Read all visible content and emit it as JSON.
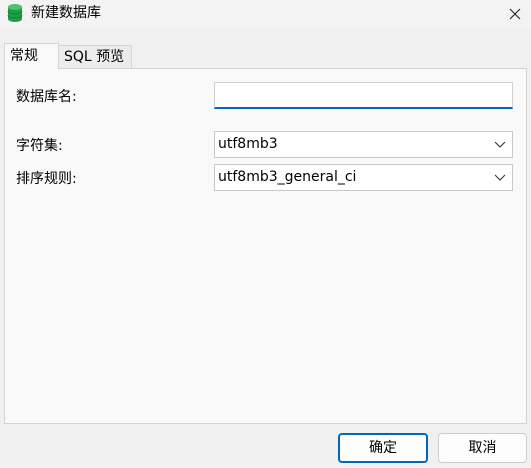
{
  "window": {
    "title": "新建数据库",
    "icon": "database-icon",
    "accent_color": "#0067c0"
  },
  "tabs": [
    {
      "label": "常规",
      "active": true
    },
    {
      "label": "SQL 预览",
      "active": false
    }
  ],
  "form": {
    "db_name_label": "数据库名:",
    "db_name_value": "",
    "charset_label": "字符集:",
    "charset_value": "utf8mb3",
    "collation_label": "排序规则:",
    "collation_value": "utf8mb3_general_ci"
  },
  "buttons": {
    "ok": "确定",
    "cancel": "取消"
  }
}
